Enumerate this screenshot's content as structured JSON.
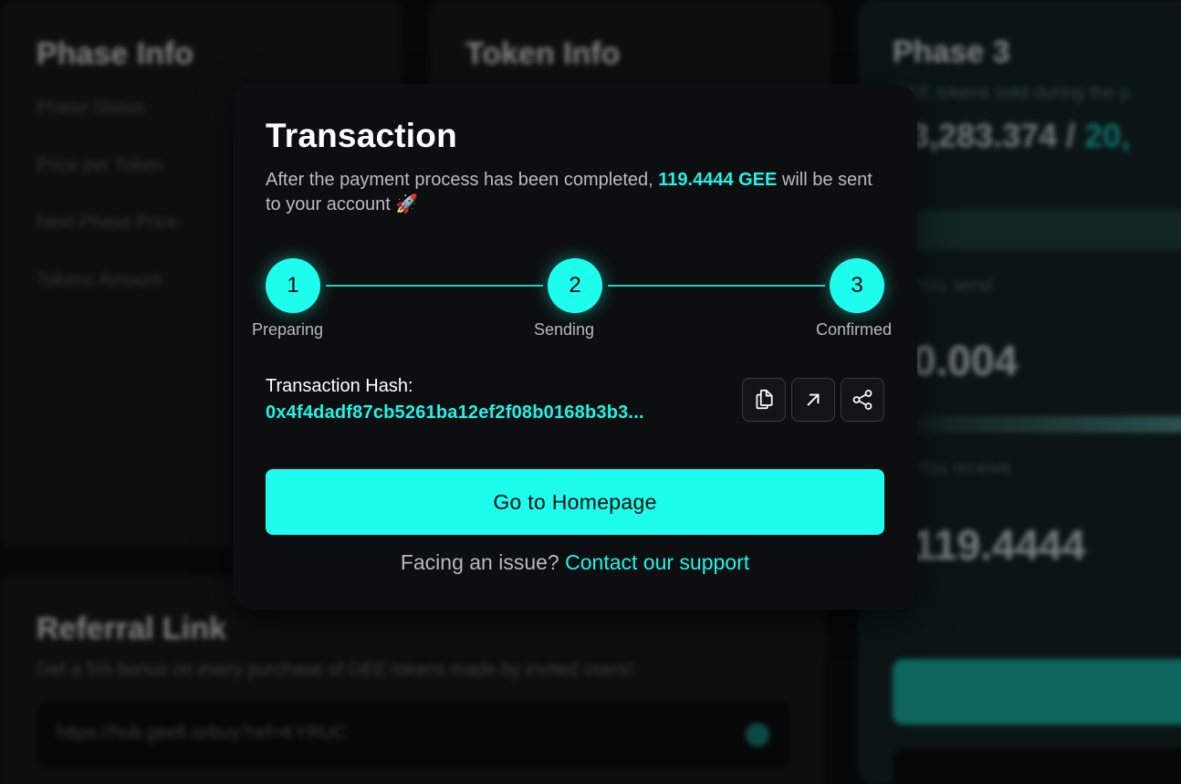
{
  "background": {
    "phase_info": {
      "title": "Phase Info",
      "rows": [
        "Phase Status",
        "Price per Token",
        "Next Phase Price",
        "Tokens Amount"
      ]
    },
    "token_info": {
      "title": "Token Info"
    },
    "phase3": {
      "title": "Phase 3",
      "sold_text": "GEE tokens sold during the p",
      "sold_amount": "23,283.374 / ",
      "sold_total": "20,",
      "you_send_label": "You send",
      "you_send_value": "0.004",
      "you_receive_label": "You receive",
      "you_receive_value": "119.4444"
    },
    "referral": {
      "title": "Referral Link",
      "subtitle": "Get a 5% bonus on every purchase of GEE tokens made by invited users!",
      "link": "https://hub.geefi.io/buy?ref=KYRUC"
    }
  },
  "modal": {
    "title": "Transaction",
    "desc_prefix": "After the payment process has been completed, ",
    "desc_amount": "119.4444 GEE",
    "desc_suffix": " will be sent to your account 🚀",
    "steps": [
      {
        "number": "1",
        "label": "Preparing"
      },
      {
        "number": "2",
        "label": "Sending"
      },
      {
        "number": "3",
        "label": "Confirmed"
      }
    ],
    "hash_label": "Transaction Hash:",
    "hash_value": "0x4f4dadf87cb5261ba12ef2f08b0168b3b3...",
    "icons": [
      "copy-icon",
      "external-link-icon",
      "share-icon"
    ],
    "home_button": "Go to Homepage",
    "support_prefix": "Facing an issue? ",
    "support_link": "Contact our support"
  },
  "colors": {
    "accent": "#1dfeee",
    "modal_bg": "#0d0e0f",
    "text_muted": "#b6b9ba"
  }
}
